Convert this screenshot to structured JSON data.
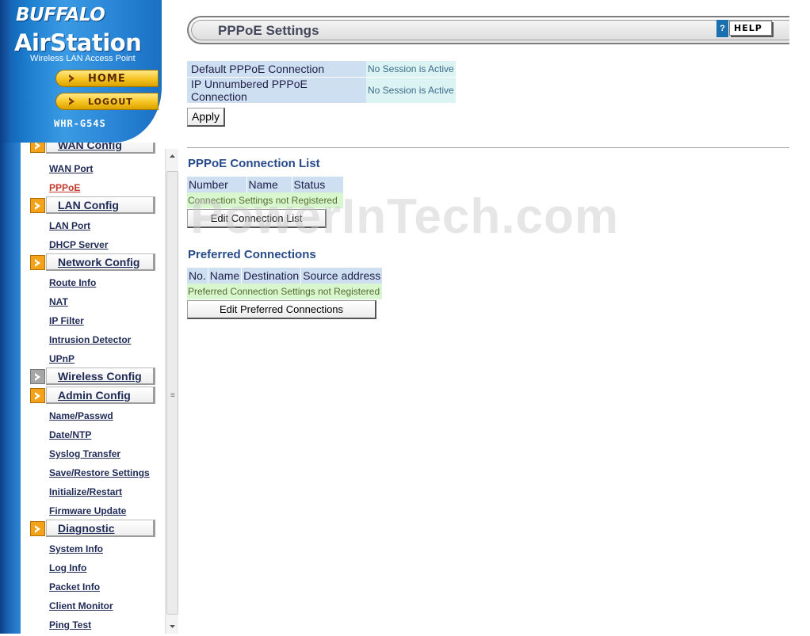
{
  "brand": {
    "logo_top": "BUFFALO",
    "logo_main": "AirStation",
    "tagline": "Wireless LAN Access Point",
    "home_label": "HOME",
    "logout_label": "LOGOUT",
    "model": "WHR-G54S"
  },
  "nav": {
    "sections": [
      {
        "label": "WAN Config",
        "links": [
          "WAN Port",
          "PPPoE"
        ]
      },
      {
        "label": "LAN Config",
        "links": [
          "LAN Port",
          "DHCP Server"
        ]
      },
      {
        "label": "Network Config",
        "links": [
          "Route Info",
          "NAT",
          "IP Filter",
          "Intrusion Detector",
          "UPnP"
        ]
      },
      {
        "label": "Wireless Config",
        "links": []
      },
      {
        "label": "Admin Config",
        "links": [
          "Name/Passwd",
          "Date/NTP",
          "Syslog Transfer",
          "Save/Restore Settings",
          "Initialize/Restart",
          "Firmware Update"
        ]
      },
      {
        "label": "Diagnostic",
        "links": [
          "System Info",
          "Log Info",
          "Packet Info",
          "Client Monitor",
          "Ping Test"
        ]
      }
    ],
    "active_link": "PPPoE"
  },
  "page": {
    "title": "PPPoE Settings",
    "help_label": "HELP",
    "help_icon": "?"
  },
  "status": {
    "rows": [
      {
        "label": "Default PPPoE Connection",
        "value": "No Session is Active"
      },
      {
        "label": "IP Unnumbered PPPoE Connection",
        "value": "No Session is Active"
      }
    ]
  },
  "apply_label": "Apply",
  "connection_list": {
    "heading": "PPPoE Connection List",
    "columns": [
      "Number",
      "Name",
      "Status"
    ],
    "empty_message": "Connection Settings not Registered",
    "button_label": "Edit Connection List"
  },
  "preferred": {
    "heading": "Preferred Connections",
    "columns": [
      "No.",
      "Name",
      "Destination",
      "Source address"
    ],
    "empty_message": "Preferred Connection Settings not Registered",
    "button_label": "Edit Preferred Connections"
  },
  "watermark": "PowerInTech.com",
  "colors": {
    "accent_blue": "#1e7fd0",
    "nav_orange": "#f4a21a",
    "heading_blue": "#274b88",
    "header_cell": "#cfdff2",
    "status_cell": "#dcf3f3",
    "empty_row": "#d9f7cf",
    "active_link": "#c0392b"
  }
}
